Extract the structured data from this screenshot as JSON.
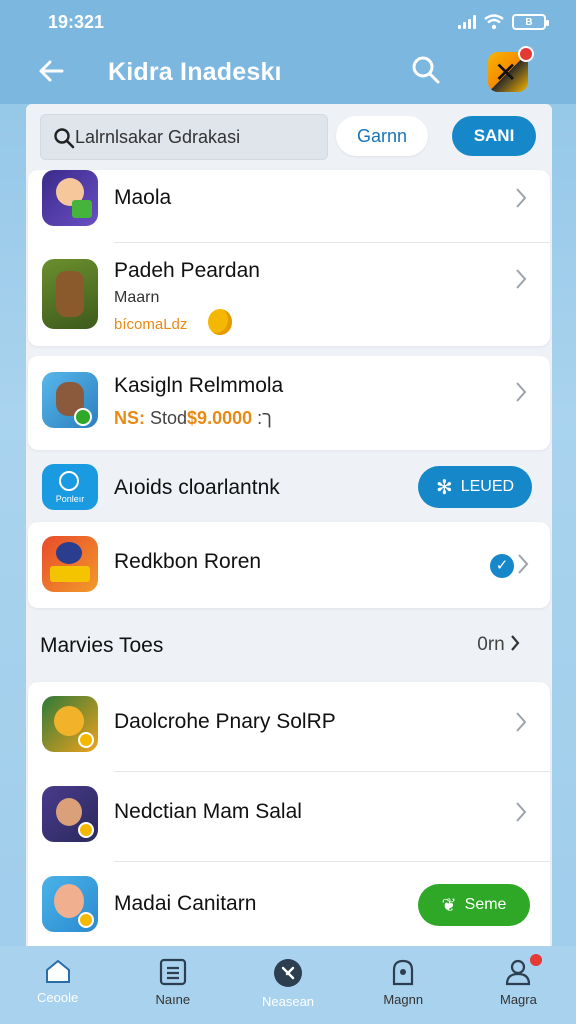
{
  "status_bar": {
    "time": "19:321",
    "battery": "B"
  },
  "header": {
    "title": "Kidra Inadeskı"
  },
  "search": {
    "value": "Lalrnlsakar Gdrakasi",
    "outline_button": "Garnn",
    "filled_button": "SANI"
  },
  "apps": [
    {
      "title": "Maola"
    },
    {
      "title": "Padeh Peardan",
      "subtitle": "Maarn",
      "tag": "bícomaLdz"
    },
    {
      "title": "Kasigln Relmmola",
      "price_label": "NS:",
      "price_text": "Stodך:",
      "price_value": "$9.0000"
    },
    {
      "title": "Aıoids cloarlantnk",
      "icon_text": "Ponleır",
      "action_label": "LEUED"
    },
    {
      "title": "Redkbon Roren"
    }
  ],
  "section": {
    "title": "Marvies Toes",
    "more": "0rn"
  },
  "more_apps": [
    {
      "title": "Daolcrohe Pnary SolRP"
    },
    {
      "title": "Nedctian Mam Salal"
    },
    {
      "title": "Madai Canitarn",
      "action_label": "Seme"
    }
  ],
  "nav": [
    {
      "label": "Ceoole",
      "icon": "home-icon"
    },
    {
      "label": "Naıne",
      "icon": "list-icon"
    },
    {
      "label": "Neasean",
      "icon": "compass-icon"
    },
    {
      "label": "Magnn",
      "icon": "bag-icon"
    },
    {
      "label": "Magra",
      "icon": "profile-icon"
    }
  ],
  "colors": {
    "accent": "#1687c9",
    "header": "#7cb7e0",
    "green": "#2fa827",
    "price": "#e88a14"
  }
}
